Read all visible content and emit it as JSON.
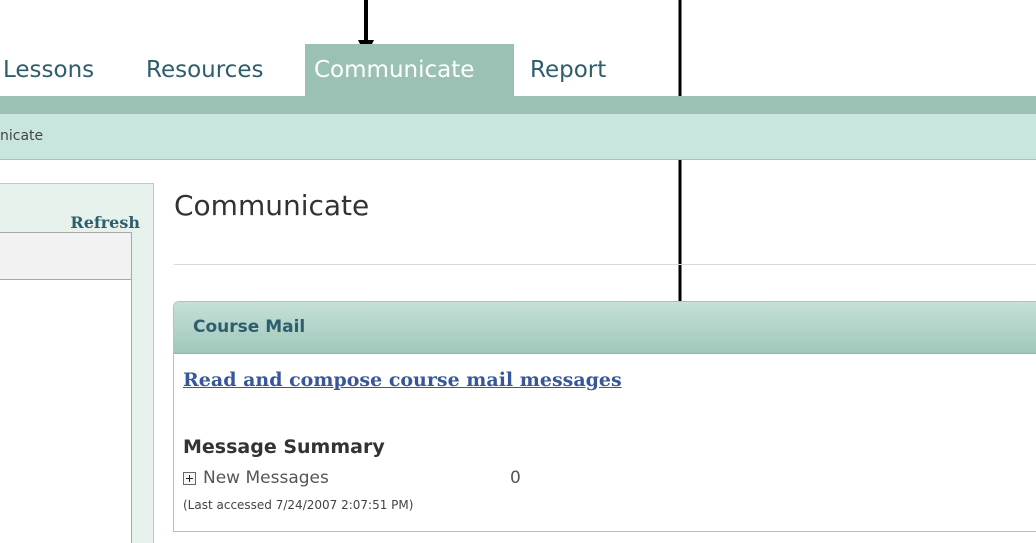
{
  "tabs": [
    {
      "label": "Lessons"
    },
    {
      "label": "Resources"
    },
    {
      "label": "Communicate"
    },
    {
      "label": "Report"
    }
  ],
  "active_tab": "Communicate",
  "breadcrumb": {
    "text": "nicate"
  },
  "left_panel": {
    "refresh_label": "Refresh"
  },
  "main": {
    "title": "Communicate",
    "course_mail": {
      "header": "Course Mail",
      "link_text": "Read and compose course mail messages",
      "summary_heading": "Message Summary",
      "new_messages_label": "New Messages",
      "new_messages_count": "0",
      "last_accessed": "(Last accessed 7/24/2007 2:07:51 PM)"
    }
  },
  "colors": {
    "tab_active_bg": "#9bc1b4",
    "crumb_bg": "#c9e6de",
    "link": "#36579a",
    "heading_teal": "#2e5e6c"
  },
  "icons": {
    "expand": "plus-box-icon",
    "annotation": "down-arrow-icon"
  }
}
